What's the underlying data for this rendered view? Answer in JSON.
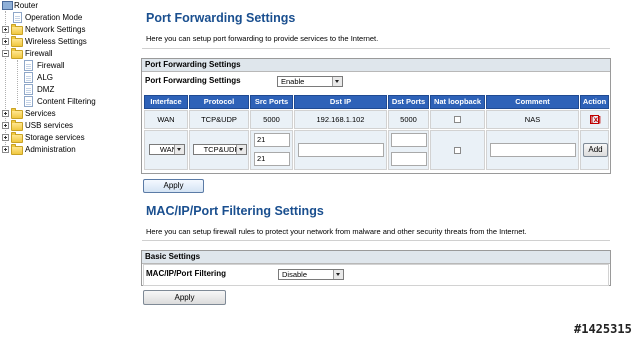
{
  "sidebar": {
    "root": "Router",
    "items": [
      {
        "label": "Operation Mode"
      },
      {
        "label": "Network Settings"
      },
      {
        "label": "Wireless Settings"
      },
      {
        "label": "Firewall"
      },
      {
        "label": "Firewall"
      },
      {
        "label": "ALG"
      },
      {
        "label": "DMZ"
      },
      {
        "label": "Content Filtering"
      },
      {
        "label": "Services"
      },
      {
        "label": "USB services"
      },
      {
        "label": "Storage services"
      },
      {
        "label": "Administration"
      }
    ]
  },
  "port_forwarding": {
    "title": "Port Forwarding Settings",
    "description": "Here you can setup port forwarding to provide services to the Internet.",
    "panel_title": "Port Forwarding Settings",
    "setting_label": "Port Forwarding Settings",
    "setting_value": "Enable",
    "columns": [
      "Interface",
      "Protocol",
      "Src Ports",
      "Dst IP",
      "Dst Ports",
      "Nat loopback",
      "Comment",
      "Action"
    ],
    "rules": [
      {
        "interface": "WAN",
        "protocol": "TCP&UDP",
        "src_ports": "5000",
        "dst_ip": "192.168.1.102",
        "dst_ports": "5000",
        "nat_loopback": false,
        "comment": "NAS",
        "action": "[x]"
      }
    ],
    "new_rule": {
      "interface": "WAN",
      "protocol": "TCP&UDP",
      "src_port_from": "21",
      "src_port_to": "21",
      "dst_ip": "",
      "dst_port_from": "",
      "dst_port_to": "",
      "nat_loopback": false,
      "comment": "",
      "add_label": "Add"
    },
    "apply_label": "Apply"
  },
  "mac_filtering": {
    "title": "MAC/IP/Port Filtering Settings",
    "description": "Here you can setup firewall rules to protect your network from malware and other security threats from the Internet.",
    "panel_title": "Basic Settings",
    "setting_label": "MAC/IP/Port Filtering",
    "setting_value": "Disable",
    "apply_label": "Apply"
  },
  "watermark": "#1425315"
}
